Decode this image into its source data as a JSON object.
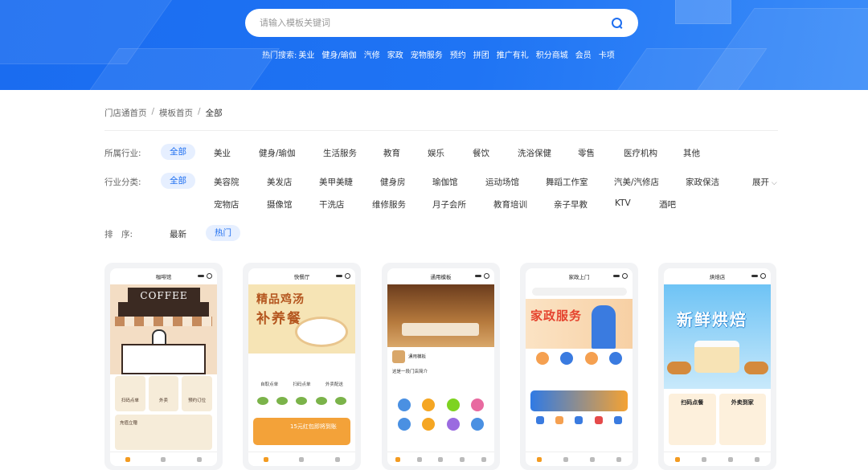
{
  "search": {
    "placeholder": "请输入模板关键词",
    "hot_label": "热门搜索:",
    "hot_keywords": [
      "美业",
      "健身/瑜伽",
      "汽修",
      "家政",
      "宠物服务",
      "预约",
      "拼团",
      "推广有礼",
      "积分商城",
      "会员",
      "卡项"
    ]
  },
  "breadcrumb": [
    "门店通首页",
    "模板首页",
    "全部"
  ],
  "filters": {
    "industry": {
      "label": "所属行业:",
      "options": [
        "全部",
        "美业",
        "健身/瑜伽",
        "生活服务",
        "教育",
        "娱乐",
        "餐饮",
        "洗浴保健",
        "零售",
        "医疗机构",
        "其他"
      ],
      "selected": "全部"
    },
    "category": {
      "label": "行业分类:",
      "options_row1": [
        "全部",
        "美容院",
        "美发店",
        "美甲美睫",
        "健身房",
        "瑜伽馆",
        "运动场馆",
        "舞蹈工作室",
        "汽美/汽修店",
        "家政保洁"
      ],
      "options_row2": [
        "宠物店",
        "摄像馆",
        "干洗店",
        "维修服务",
        "月子会所",
        "教育培训",
        "亲子早教",
        "KTV",
        "酒吧"
      ],
      "selected": "全部",
      "expand_label": "展开"
    },
    "sort": {
      "label": "排　序:",
      "options": [
        "最新",
        "热门"
      ],
      "selected": "热门"
    }
  },
  "templates": [
    {
      "title": "咖啡馆",
      "sign": "COFFEE",
      "buttons": [
        "扫码点单",
        "外卖",
        "预约订位"
      ],
      "panel": "充值立赠"
    },
    {
      "title": "快餐厅",
      "banner_line1": "精品鸡汤",
      "banner_line2": "补养餐",
      "icons": [
        "自取点单",
        "扫码点单",
        "外卖配送"
      ],
      "promo": "15元红包即将到账"
    },
    {
      "title": "通用模板",
      "shop_name": "通用模板",
      "info_line": "这是一段门店简介"
    },
    {
      "title": "家政上门",
      "banner": "家政服务"
    },
    {
      "title": "烘焙店",
      "banner": "新鲜烘焙",
      "tiles": [
        "扫码点餐",
        "外卖到家"
      ]
    }
  ],
  "colors": {
    "primary": "#1f6ff0",
    "pill_bg": "#e6efff",
    "hero": "#1f74f4"
  }
}
